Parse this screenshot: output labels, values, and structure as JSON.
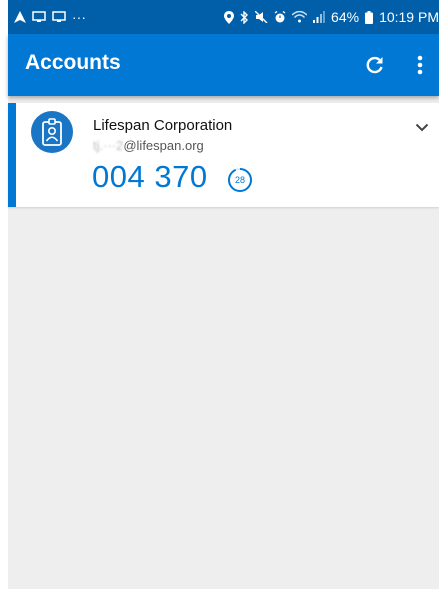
{
  "status_bar": {
    "battery": "64%",
    "time": "10:19 PM",
    "notification_icons": [
      "navigation-icon",
      "cast-icon",
      "cast-icon",
      "more-notifications-icon"
    ],
    "system_icons": [
      "location-icon",
      "bluetooth-icon",
      "mute-icon",
      "alarm-icon",
      "wifi-icon",
      "signal-icon",
      "battery-icon"
    ],
    "more_glyph": "···"
  },
  "app_bar": {
    "title": "Accounts",
    "refresh_icon": "refresh-icon",
    "menu_icon": "more-vert-icon"
  },
  "accounts": [
    {
      "name": "Lifespan Corporation",
      "email_masked": "tj.···2",
      "email_domain": "@lifespan.org",
      "code": "004 370",
      "seconds_remaining": "28",
      "timer_fraction_remaining": 0.93,
      "avatar_icon": "id-badge-icon",
      "expand_icon": "chevron-down-icon"
    }
  ],
  "colors": {
    "status_bar": "#005fa8",
    "app_bar": "#0078d4",
    "accent": "#0078d4",
    "background": "#eeeeee"
  }
}
